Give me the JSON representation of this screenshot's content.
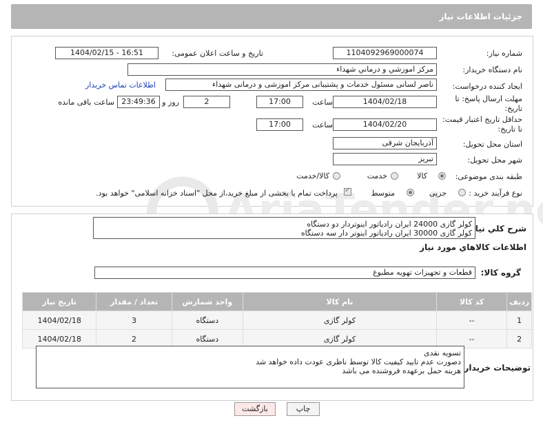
{
  "header": {
    "title": "جزئیات اطلاعات نیاز"
  },
  "form": {
    "need_number_label": "شماره نیاز:",
    "need_number": "1104092969000074",
    "announce_label": "تاریخ و ساعت اعلان عمومی:",
    "announce_value": "1404/02/15 - 16:51",
    "buyer_org_label": "نام دستگاه خریدار:",
    "buyer_org": "مرکز اموزشي و درماني شهداء",
    "requester_label": "ایجاد کننده درخواست:",
    "requester": "ناصر لسانی مسئول خدمات و پشتیبانی مرکز اموزشی و درمانی شهداء",
    "contact_link": "اطلاعات تماس خریدار",
    "reply_deadline_label_1": "مهلت ارسال پاسخ: تا",
    "reply_deadline_label_2": "تاریخ:",
    "reply_date": "1404/02/18",
    "time_label": "ساعت",
    "reply_time": "17:00",
    "days": "2",
    "days_label": "روز و",
    "remaining_time": "23:49:36",
    "remaining_label": "ساعت باقی مانده",
    "price_deadline_label_1": "حداقل تاریخ اعتبار قیمت:",
    "price_deadline_label_2": "تا تاریخ:",
    "price_date": "1404/02/20",
    "price_time": "17:00",
    "province_label": "استان محل تحویل:",
    "province": "آذربایجان شرقی",
    "city_label": "شهر محل تحویل:",
    "city": "تبریز",
    "category_label": "طبقه بندی موضوعی:",
    "category_options": [
      "کالا",
      "خدمت",
      "کالا/خدمت"
    ],
    "process_label": "نوع فرآیند خرید :",
    "process_options": [
      "جزیی",
      "متوسط"
    ],
    "payment_note": "پرداخت تمام یا بخشی از مبلغ خرید،از محل \"اسناد خزانه اسلامی\" خواهد بود."
  },
  "description": {
    "label": "شرح کلي نياز:",
    "lines": [
      "کولر گازی 24000 ایران رادیاتور اینوتردار دو دستگاه",
      "کولر گازی 30000 ایران رادیاتور اینوتر دار سه دستگاه"
    ]
  },
  "goods_section": {
    "title": "اطلاعات کالاهاي مورد نياز",
    "group_label": "گروه کالا:",
    "group_value": "قطعات و تجهیزات تهویه مطبوع"
  },
  "table": {
    "headers": [
      "ردیف",
      "کد کالا",
      "نام کالا",
      "واحد شمارش",
      "تعداد / مقدار",
      "تاریخ نیاز"
    ],
    "rows": [
      [
        "1",
        "--",
        "کولر گازی",
        "دستگاه",
        "3",
        "1404/02/18"
      ],
      [
        "2",
        "--",
        "کولر گازی",
        "دستگاه",
        "2",
        "1404/02/18"
      ]
    ]
  },
  "buyer_notes": {
    "label": "توضیحات خریدار:",
    "lines": [
      "تسویه نقدی",
      "دصورت عدم تایید کیفیت کالا توسط ناظری عودت داده خواهد شد",
      "هزینه حمل برعهده فروشنده می باشد"
    ]
  },
  "buttons": {
    "print": "چاپ",
    "back": "بازگشت"
  },
  "colors": {
    "header_bg": "#b5b5b5",
    "link": "#1a3fb5",
    "back_btn_bg": "#fde8e8"
  }
}
